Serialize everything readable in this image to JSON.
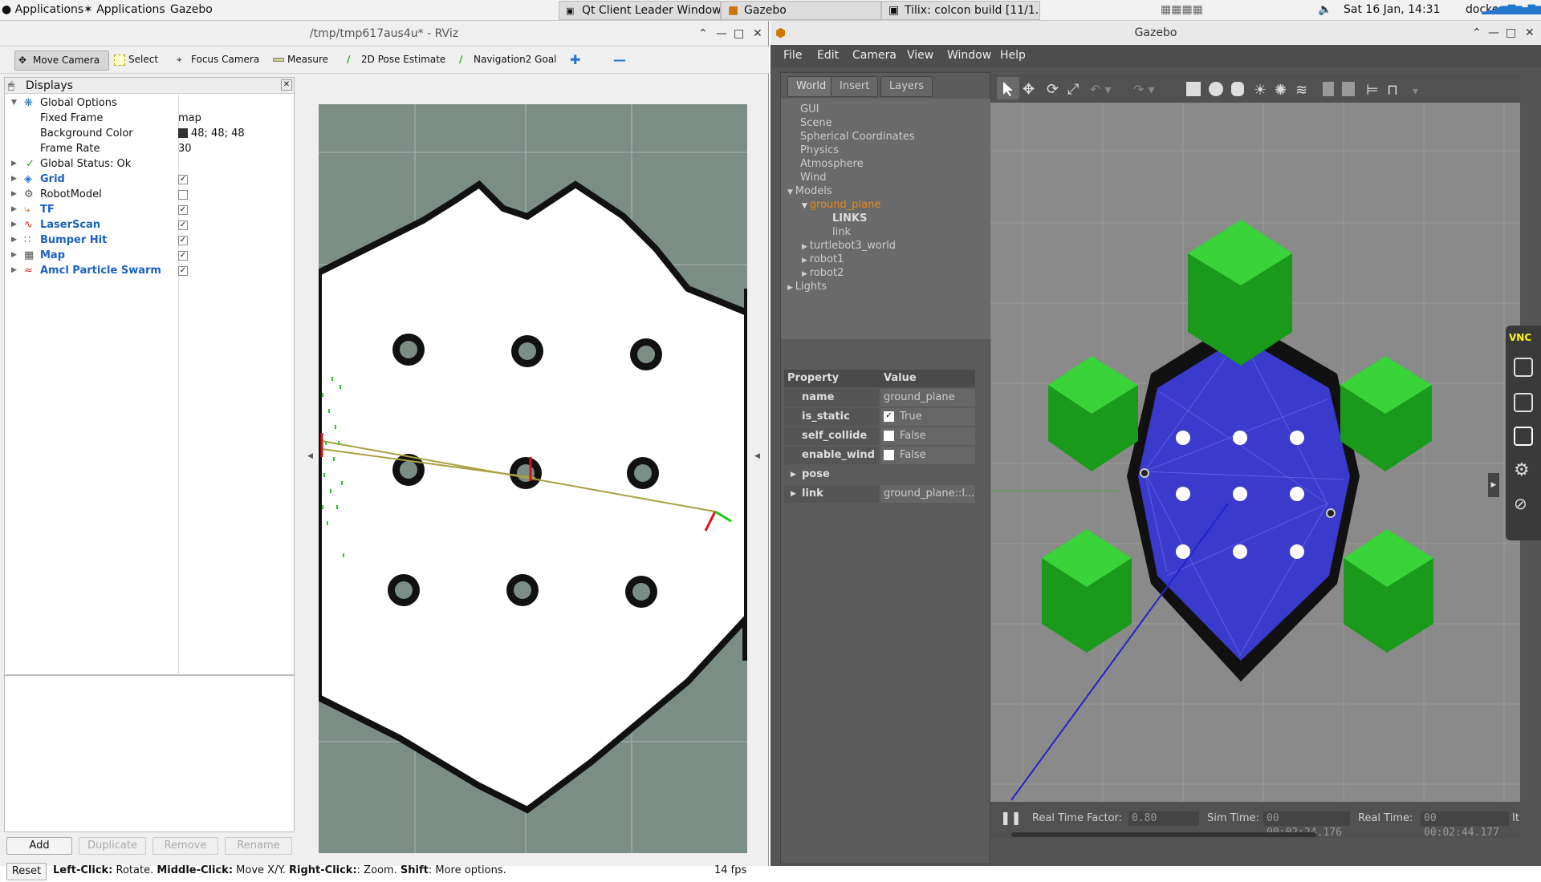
{
  "taskbar": {
    "apps1": "Applications",
    "apps2": "Applications",
    "gazebo": "Gazebo",
    "windows": [
      {
        "label": "Qt Client Leader Window"
      },
      {
        "label": "Gazebo"
      },
      {
        "label": "Tilix: colcon build [11/1..."
      }
    ],
    "clock": "Sat 16 Jan, 14:31",
    "user": "docker"
  },
  "rviz": {
    "title": "/tmp/tmp617aus4u* - RViz",
    "tools": [
      "Move Camera",
      "Select",
      "Focus Camera",
      "Measure",
      "2D Pose Estimate",
      "Navigation2 Goal"
    ],
    "displays_title": "Displays",
    "tree": {
      "global_options": "Global Options",
      "fixed_frame_label": "Fixed Frame",
      "fixed_frame_value": "map",
      "bg_label": "Background Color",
      "bg_value": "48; 48; 48",
      "fr_label": "Frame Rate",
      "fr_value": "30",
      "global_status": "Global Status: Ok",
      "items": [
        {
          "label": "Grid",
          "checked": true
        },
        {
          "label": "RobotModel",
          "checked": false
        },
        {
          "label": "TF",
          "checked": true
        },
        {
          "label": "LaserScan",
          "checked": true
        },
        {
          "label": "Bumper Hit",
          "checked": true
        },
        {
          "label": "Map",
          "checked": true
        },
        {
          "label": "Amcl Particle Swarm",
          "checked": true
        }
      ]
    },
    "buttons": {
      "add": "Add",
      "duplicate": "Duplicate",
      "remove": "Remove",
      "rename": "Rename"
    },
    "status": {
      "reset": "Reset",
      "left_click": "Left-Click:",
      "left_click_text": " Rotate. ",
      "middle_click": "Middle-Click:",
      "middle_click_text": " Move X/Y. ",
      "right_click": "Right-Click:",
      "right_click_text": ": Zoom. ",
      "shift": "Shift",
      "shift_text": ": More options.",
      "fps": "14 fps"
    }
  },
  "gazebo": {
    "title": "Gazebo",
    "menu": [
      "File",
      "Edit",
      "Camera",
      "View",
      "Window",
      "Help"
    ],
    "tabs": [
      "World",
      "Insert",
      "Layers"
    ],
    "tree": {
      "gui": "GUI",
      "scene": "Scene",
      "spherical": "Spherical Coordinates",
      "physics": "Physics",
      "atmosphere": "Atmosphere",
      "wind": "Wind",
      "models": "Models",
      "ground_plane": "ground_plane",
      "links": "LINKS",
      "link": "link",
      "turtlebot3_world": "turtlebot3_world",
      "robot1": "robot1",
      "robot2": "robot2",
      "lights": "Lights"
    },
    "props": {
      "header_property": "Property",
      "header_value": "Value",
      "name_label": "name",
      "name_value": "ground_plane",
      "is_static_label": "is_static",
      "is_static_value": "True",
      "self_collide_label": "self_collide",
      "self_collide_value": "False",
      "enable_wind_label": "enable_wind",
      "enable_wind_value": "False",
      "pose_label": "pose",
      "link_label": "link",
      "link_value": "ground_plane::l..."
    },
    "bottom": {
      "rtf_label": "Real Time Factor:",
      "rtf_value": "0.80",
      "sim_label": "Sim Time:",
      "sim_value": "00 00:02:24.176",
      "real_label": "Real Time:",
      "real_value": "00 00:02:44.177",
      "it_label": "It"
    }
  },
  "vnc": {
    "logo": "VNC"
  }
}
